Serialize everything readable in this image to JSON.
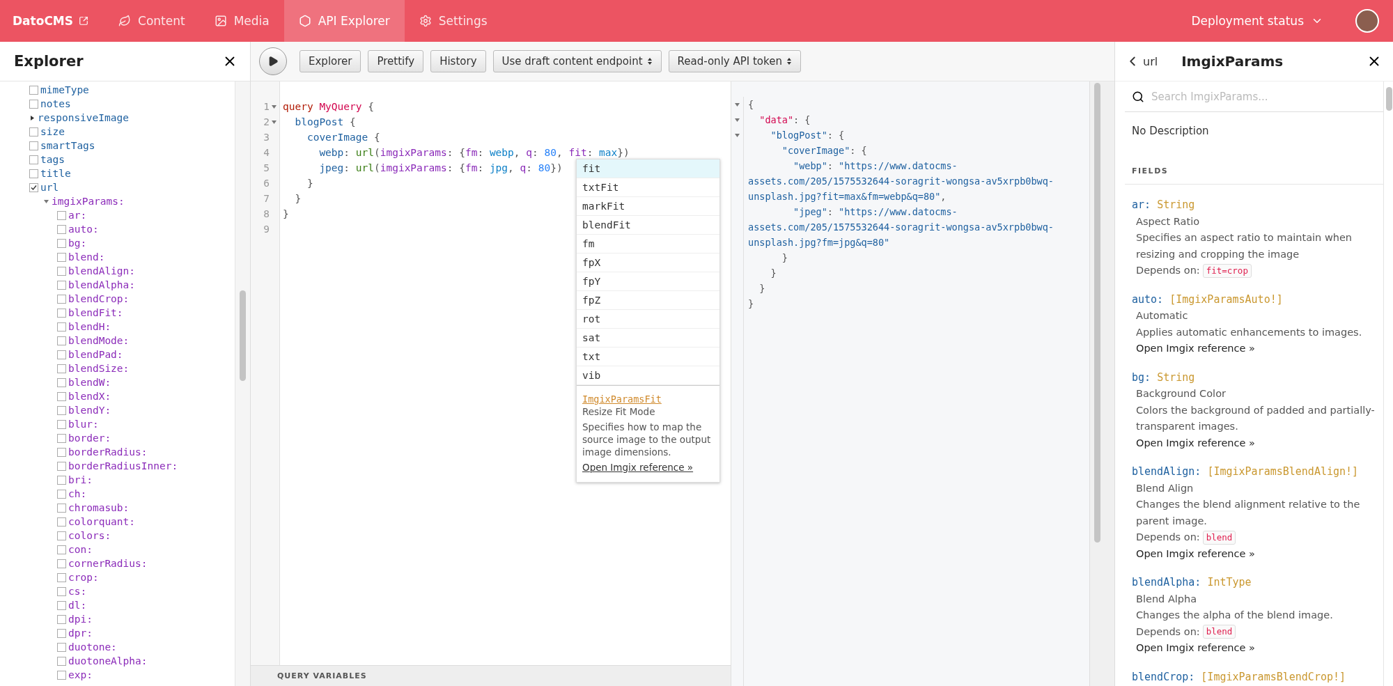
{
  "nav": {
    "brand": "DatoCMS",
    "tabs": [
      {
        "label": "Content",
        "selected": false
      },
      {
        "label": "Media",
        "selected": false
      },
      {
        "label": "API Explorer",
        "selected": true
      },
      {
        "label": "Settings",
        "selected": false
      }
    ],
    "deployment": "Deployment status"
  },
  "explorer": {
    "title": "Explorer",
    "items": [
      {
        "label": "mimeType",
        "kind": "field",
        "checked": false
      },
      {
        "label": "notes",
        "kind": "field",
        "checked": false
      },
      {
        "label": "responsiveImage",
        "kind": "object",
        "expanded": false
      },
      {
        "label": "size",
        "kind": "field",
        "checked": false
      },
      {
        "label": "smartTags",
        "kind": "field",
        "checked": false
      },
      {
        "label": "tags",
        "kind": "field",
        "checked": false
      },
      {
        "label": "title",
        "kind": "field",
        "checked": false
      },
      {
        "label": "url",
        "kind": "field",
        "checked": true,
        "children": [
          {
            "label": "imgixParams:",
            "kind": "arguments",
            "expanded": true,
            "children": [
              {
                "label": "ar:",
                "kind": "argument",
                "checked": false
              },
              {
                "label": "auto:",
                "kind": "argument",
                "checked": false
              },
              {
                "label": "bg:",
                "kind": "argument",
                "checked": false
              },
              {
                "label": "blend:",
                "kind": "argument",
                "checked": false
              },
              {
                "label": "blendAlign:",
                "kind": "argument",
                "checked": false
              },
              {
                "label": "blendAlpha:",
                "kind": "argument",
                "checked": false
              },
              {
                "label": "blendCrop:",
                "kind": "argument",
                "checked": false
              },
              {
                "label": "blendFit:",
                "kind": "argument",
                "checked": false
              },
              {
                "label": "blendH:",
                "kind": "argument",
                "checked": false
              },
              {
                "label": "blendMode:",
                "kind": "argument",
                "checked": false
              },
              {
                "label": "blendPad:",
                "kind": "argument",
                "checked": false
              },
              {
                "label": "blendSize:",
                "kind": "argument",
                "checked": false
              },
              {
                "label": "blendW:",
                "kind": "argument",
                "checked": false
              },
              {
                "label": "blendX:",
                "kind": "argument",
                "checked": false
              },
              {
                "label": "blendY:",
                "kind": "argument",
                "checked": false
              },
              {
                "label": "blur:",
                "kind": "argument",
                "checked": false
              },
              {
                "label": "border:",
                "kind": "argument",
                "checked": false
              },
              {
                "label": "borderRadius:",
                "kind": "argument",
                "checked": false
              },
              {
                "label": "borderRadiusInner:",
                "kind": "argument",
                "checked": false
              },
              {
                "label": "bri:",
                "kind": "argument",
                "checked": false
              },
              {
                "label": "ch:",
                "kind": "argument",
                "checked": false
              },
              {
                "label": "chromasub:",
                "kind": "argument",
                "checked": false
              },
              {
                "label": "colorquant:",
                "kind": "argument",
                "checked": false
              },
              {
                "label": "colors:",
                "kind": "argument",
                "checked": false
              },
              {
                "label": "con:",
                "kind": "argument",
                "checked": false
              },
              {
                "label": "cornerRadius:",
                "kind": "argument",
                "checked": false
              },
              {
                "label": "crop:",
                "kind": "argument",
                "checked": false
              },
              {
                "label": "cs:",
                "kind": "argument",
                "checked": false
              },
              {
                "label": "dl:",
                "kind": "argument",
                "checked": false
              },
              {
                "label": "dpi:",
                "kind": "argument",
                "checked": false
              },
              {
                "label": "dpr:",
                "kind": "argument",
                "checked": false
              },
              {
                "label": "duotone:",
                "kind": "argument",
                "checked": false
              },
              {
                "label": "duotoneAlpha:",
                "kind": "argument",
                "checked": false
              },
              {
                "label": "exp:",
                "kind": "argument",
                "checked": false
              }
            ]
          }
        ]
      }
    ]
  },
  "toolbar": {
    "buttons": [
      {
        "label": "Explorer",
        "kind": "button"
      },
      {
        "label": "Prettify",
        "kind": "button"
      },
      {
        "label": "History",
        "kind": "button"
      },
      {
        "label": "Use draft content endpoint",
        "kind": "select"
      },
      {
        "label": "Read-only API token",
        "kind": "select"
      }
    ]
  },
  "editor": {
    "lines": [
      {
        "number": "1",
        "foldable": true,
        "tokens": [
          {
            "text": "query",
            "kind": "keyword"
          },
          {
            "text": " MyQuery",
            "kind": "def"
          },
          {
            "text": " {",
            "kind": "punct"
          }
        ]
      },
      {
        "number": "2",
        "foldable": true,
        "tokens": [
          {
            "text": "  blogPost",
            "kind": "field"
          },
          {
            "text": " {",
            "kind": "punct"
          }
        ]
      },
      {
        "number": "3",
        "foldable": false,
        "tokens": [
          {
            "text": "    coverImage",
            "kind": "field"
          },
          {
            "text": " {",
            "kind": "punct"
          }
        ]
      },
      {
        "number": "4",
        "foldable": false,
        "tokens": [
          {
            "text": "      webp",
            "kind": "field"
          },
          {
            "text": ": ",
            "kind": "punct"
          },
          {
            "text": "url",
            "kind": "call"
          },
          {
            "text": "(",
            "kind": "punct"
          },
          {
            "text": "imgixParams",
            "kind": "arg"
          },
          {
            "text": ": {",
            "kind": "punct"
          },
          {
            "text": "fm",
            "kind": "arg"
          },
          {
            "text": ": ",
            "kind": "punct"
          },
          {
            "text": "webp",
            "kind": "enum"
          },
          {
            "text": ", ",
            "kind": "punct"
          },
          {
            "text": "q",
            "kind": "arg"
          },
          {
            "text": ": ",
            "kind": "punct"
          },
          {
            "text": "80",
            "kind": "number"
          },
          {
            "text": ", ",
            "kind": "punct"
          },
          {
            "text": "fit",
            "kind": "arg"
          },
          {
            "text": ": ",
            "kind": "punct"
          },
          {
            "text": "max",
            "kind": "enum"
          },
          {
            "text": "})",
            "kind": "punct"
          }
        ]
      },
      {
        "number": "5",
        "foldable": false,
        "tokens": [
          {
            "text": "      jpeg",
            "kind": "field"
          },
          {
            "text": ": ",
            "kind": "punct"
          },
          {
            "text": "url",
            "kind": "call"
          },
          {
            "text": "(",
            "kind": "punct"
          },
          {
            "text": "imgixParams",
            "kind": "arg"
          },
          {
            "text": ": {",
            "kind": "punct"
          },
          {
            "text": "fm",
            "kind": "arg"
          },
          {
            "text": ": ",
            "kind": "punct"
          },
          {
            "text": "jpg",
            "kind": "enum"
          },
          {
            "text": ", ",
            "kind": "punct"
          },
          {
            "text": "q",
            "kind": "arg"
          },
          {
            "text": ": ",
            "kind": "punct"
          },
          {
            "text": "80",
            "kind": "number"
          },
          {
            "text": "})",
            "kind": "punct"
          }
        ]
      },
      {
        "number": "6",
        "foldable": false,
        "tokens": [
          {
            "text": "    }",
            "kind": "punct"
          }
        ]
      },
      {
        "number": "7",
        "foldable": false,
        "tokens": [
          {
            "text": "  }",
            "kind": "punct"
          }
        ]
      },
      {
        "number": "8",
        "foldable": false,
        "tokens": [
          {
            "text": "}",
            "kind": "punct"
          }
        ]
      },
      {
        "number": "9",
        "foldable": false
      }
    ],
    "variables_label": "QUERY VARIABLES"
  },
  "autocomplete": {
    "items": [
      {
        "label": "fit",
        "selected": true
      },
      {
        "label": "txtFit",
        "selected": false
      },
      {
        "label": "markFit",
        "selected": false
      },
      {
        "label": "blendFit",
        "selected": false
      },
      {
        "label": "fm",
        "selected": false
      },
      {
        "label": "fpX",
        "selected": false
      },
      {
        "label": "fpY",
        "selected": false
      },
      {
        "label": "fpZ",
        "selected": false
      },
      {
        "label": "rot",
        "selected": false
      },
      {
        "label": "sat",
        "selected": false
      },
      {
        "label": "txt",
        "selected": false
      },
      {
        "label": "vib",
        "selected": false
      }
    ],
    "type": "ImgixParamsFit",
    "title": "Resize Fit Mode",
    "description": "Specifies how to map the source image to the output image dimensions.",
    "link": "Open Imgix reference »"
  },
  "result": {
    "lines": [
      {
        "foldable": true,
        "tokens": [
          {
            "text": "{",
            "kind": "punct"
          }
        ]
      },
      {
        "foldable": true,
        "tokens": [
          {
            "text": "  \"data\"",
            "kind": "key_top"
          },
          {
            "text": ": {",
            "kind": "punct"
          }
        ]
      },
      {
        "foldable": true,
        "tokens": [
          {
            "text": "    \"blogPost\"",
            "kind": "key"
          },
          {
            "text": ": {",
            "kind": "punct"
          }
        ]
      },
      {
        "foldable": false,
        "tokens": [
          {
            "text": "      \"coverImage\"",
            "kind": "key"
          },
          {
            "text": ": {",
            "kind": "punct"
          }
        ]
      },
      {
        "foldable": false,
        "tokens": [
          {
            "text": "        \"webp\"",
            "kind": "key"
          },
          {
            "text": ": ",
            "kind": "punct"
          },
          {
            "text": "\"https://www.datocms-",
            "kind": "string"
          }
        ]
      },
      {
        "foldable": false,
        "tokens": [
          {
            "text": "assets.com/205/1575532644-soragrit-wongsa-av5xrpb0bwq-",
            "kind": "string"
          }
        ]
      },
      {
        "foldable": false,
        "tokens": [
          {
            "text": "unsplash.jpg?fit=max&fm=webp&q=80\"",
            "kind": "string"
          },
          {
            "text": ",",
            "kind": "punct"
          }
        ]
      },
      {
        "foldable": false,
        "tokens": [
          {
            "text": "        \"jpeg\"",
            "kind": "key"
          },
          {
            "text": ": ",
            "kind": "punct"
          },
          {
            "text": "\"https://www.datocms-",
            "kind": "string"
          }
        ]
      },
      {
        "foldable": false,
        "tokens": [
          {
            "text": "assets.com/205/1575532644-soragrit-wongsa-av5xrpb0bwq-",
            "kind": "string"
          }
        ]
      },
      {
        "foldable": false,
        "tokens": [
          {
            "text": "unsplash.jpg?fm=jpg&q=80\"",
            "kind": "string"
          }
        ]
      },
      {
        "foldable": false,
        "tokens": [
          {
            "text": "      }",
            "kind": "punct"
          }
        ]
      },
      {
        "foldable": false,
        "tokens": [
          {
            "text": "    }",
            "kind": "punct"
          }
        ]
      },
      {
        "foldable": false,
        "tokens": [
          {
            "text": "  }",
            "kind": "punct"
          }
        ]
      },
      {
        "foldable": false,
        "tokens": [
          {
            "text": "}",
            "kind": "punct"
          }
        ]
      }
    ]
  },
  "docs": {
    "back": "url",
    "title": "ImgixParams",
    "search_placeholder": "Search ImgixParams...",
    "description": "No Description",
    "section": "FIELDS",
    "fields": [
      {
        "name": "ar:",
        "type": "String",
        "title": "Aspect Ratio",
        "description": "Specifies an aspect ratio to maintain when resizing and cropping the image",
        "depends_label": "Depends on:",
        "depends": "fit=crop"
      },
      {
        "name": "auto:",
        "type": "[ImgixParamsAuto!]",
        "title": "Automatic",
        "description": "Applies automatic enhancements to images.",
        "link": "Open Imgix reference »"
      },
      {
        "name": "bg:",
        "type": "String",
        "title": "Background Color",
        "description": "Colors the background of padded and partially-transparent images.",
        "link": "Open Imgix reference »"
      },
      {
        "name": "blendAlign:",
        "type": "[ImgixParamsBlendAlign!]",
        "title": "Blend Align",
        "description": "Changes the blend alignment relative to the parent image.",
        "depends_label": "Depends on:",
        "depends": "blend",
        "link": "Open Imgix reference »"
      },
      {
        "name": "blendAlpha:",
        "type": "IntType",
        "title": "Blend Alpha",
        "description": "Changes the alpha of the blend image.",
        "depends_label": "Depends on:",
        "depends": "blend",
        "link": "Open Imgix reference »"
      },
      {
        "name": "blendCrop:",
        "type": "[ImgixParamsBlendCrop!]"
      }
    ]
  }
}
